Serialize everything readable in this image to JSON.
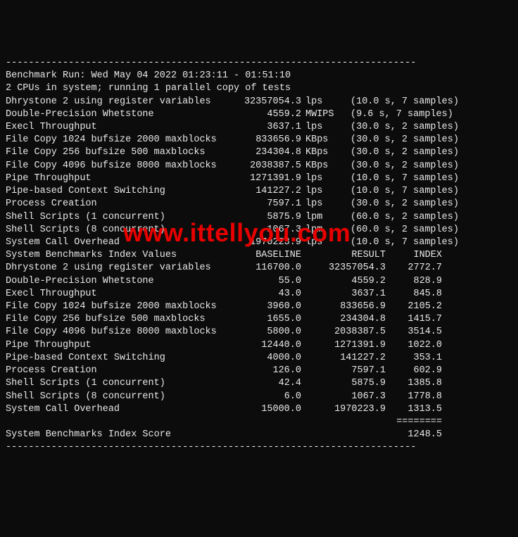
{
  "hr": "------------------------------------------------------------------------",
  "run_line": "Benchmark Run: Wed May 04 2022 01:23:11 - 01:51:10",
  "cpu_line": "2 CPUs in system; running 1 parallel copy of tests",
  "tests": [
    {
      "name": "Dhrystone 2 using register variables",
      "value": "32357054.3",
      "unit": "lps",
      "note": "(10.0 s, 7 samples)"
    },
    {
      "name": "Double-Precision Whetstone",
      "value": "4559.2",
      "unit": "MWIPS",
      "note": "(9.6 s, 7 samples)"
    },
    {
      "name": "Execl Throughput",
      "value": "3637.1",
      "unit": "lps",
      "note": "(30.0 s, 2 samples)"
    },
    {
      "name": "File Copy 1024 bufsize 2000 maxblocks",
      "value": "833656.9",
      "unit": "KBps",
      "note": "(30.0 s, 2 samples)"
    },
    {
      "name": "File Copy 256 bufsize 500 maxblocks",
      "value": "234304.8",
      "unit": "KBps",
      "note": "(30.0 s, 2 samples)"
    },
    {
      "name": "File Copy 4096 bufsize 8000 maxblocks",
      "value": "2038387.5",
      "unit": "KBps",
      "note": "(30.0 s, 2 samples)"
    },
    {
      "name": "Pipe Throughput",
      "value": "1271391.9",
      "unit": "lps",
      "note": "(10.0 s, 7 samples)"
    },
    {
      "name": "Pipe-based Context Switching",
      "value": "141227.2",
      "unit": "lps",
      "note": "(10.0 s, 7 samples)"
    },
    {
      "name": "Process Creation",
      "value": "7597.1",
      "unit": "lps",
      "note": "(30.0 s, 2 samples)"
    },
    {
      "name": "Shell Scripts (1 concurrent)",
      "value": "5875.9",
      "unit": "lpm",
      "note": "(60.0 s, 2 samples)"
    },
    {
      "name": "Shell Scripts (8 concurrent)",
      "value": "1067.3",
      "unit": "lpm",
      "note": "(60.0 s, 2 samples)"
    },
    {
      "name": "System Call Overhead",
      "value": "1970223.9",
      "unit": "lps",
      "note": "(10.0 s, 7 samples)"
    }
  ],
  "index_header": {
    "title": "System Benchmarks Index Values",
    "baseline": "BASELINE",
    "result": "RESULT",
    "index": "INDEX"
  },
  "index": [
    {
      "name": "Dhrystone 2 using register variables",
      "baseline": "116700.0",
      "result": "32357054.3",
      "index": "2772.7"
    },
    {
      "name": "Double-Precision Whetstone",
      "baseline": "55.0",
      "result": "4559.2",
      "index": "828.9"
    },
    {
      "name": "Execl Throughput",
      "baseline": "43.0",
      "result": "3637.1",
      "index": "845.8"
    },
    {
      "name": "File Copy 1024 bufsize 2000 maxblocks",
      "baseline": "3960.0",
      "result": "833656.9",
      "index": "2105.2"
    },
    {
      "name": "File Copy 256 bufsize 500 maxblocks",
      "baseline": "1655.0",
      "result": "234304.8",
      "index": "1415.7"
    },
    {
      "name": "File Copy 4096 bufsize 8000 maxblocks",
      "baseline": "5800.0",
      "result": "2038387.5",
      "index": "3514.5"
    },
    {
      "name": "Pipe Throughput",
      "baseline": "12440.0",
      "result": "1271391.9",
      "index": "1022.0"
    },
    {
      "name": "Pipe-based Context Switching",
      "baseline": "4000.0",
      "result": "141227.2",
      "index": "353.1"
    },
    {
      "name": "Process Creation",
      "baseline": "126.0",
      "result": "7597.1",
      "index": "602.9"
    },
    {
      "name": "Shell Scripts (1 concurrent)",
      "baseline": "42.4",
      "result": "5875.9",
      "index": "1385.8"
    },
    {
      "name": "Shell Scripts (8 concurrent)",
      "baseline": "6.0",
      "result": "1067.3",
      "index": "1778.8"
    },
    {
      "name": "System Call Overhead",
      "baseline": "15000.0",
      "result": "1970223.9",
      "index": "1313.5"
    }
  ],
  "eqline": "========",
  "score_label": "System Benchmarks Index Score",
  "score_value": "1248.5",
  "watermark": "www.ittellyou.com"
}
